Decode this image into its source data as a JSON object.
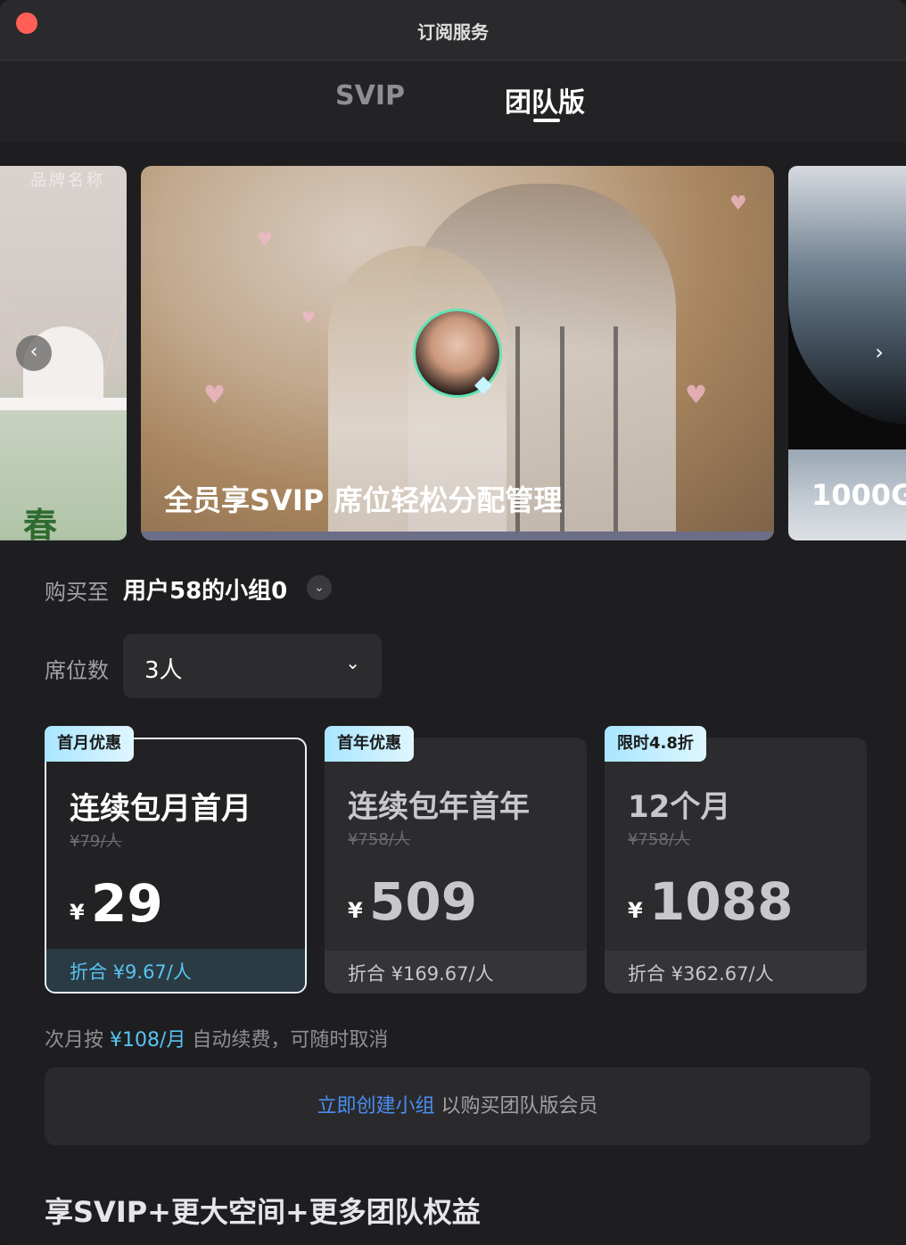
{
  "window": {
    "title": "订阅服务"
  },
  "tabs": [
    {
      "label": "SVIP",
      "active": false
    },
    {
      "label": "团队版",
      "active": true
    }
  ],
  "banners": {
    "left": {
      "brand": "品牌名称",
      "text": "春 天"
    },
    "main": {
      "caption": "全员享SVIP 席位轻松分配管理"
    },
    "right": {
      "caption": "1000G"
    },
    "prev_icon": "‹",
    "next_icon": "›"
  },
  "purchase": {
    "buy_to_label": "购买至",
    "group_name": "用户58的小组0",
    "seats_label": "席位数",
    "seats_value": "3人"
  },
  "plans": [
    {
      "badge": "首月优惠",
      "title": "连续包月首月",
      "original": "¥79/人",
      "currency": "¥",
      "price": "29",
      "per": "折合 ¥9.67/人",
      "selected": true
    },
    {
      "badge": "首年优惠",
      "title": "连续包年首年",
      "original": "¥758/人",
      "currency": "¥",
      "price": "509",
      "per": "折合 ¥169.67/人",
      "selected": false
    },
    {
      "badge": "限时4.8折",
      "title": "12个月",
      "original": "¥758/人",
      "currency": "¥",
      "price": "1088",
      "per": "折合 ¥362.67/人",
      "selected": false
    }
  ],
  "renew_note": {
    "prefix": "次月按 ",
    "price": "¥108/月",
    "suffix": " 自动续费，可随时取消"
  },
  "create_group": {
    "link": "立即创建小组",
    "text": " 以购买团队版会员"
  },
  "section_title": "享SVIP+更大空间+更多团队权益",
  "colors": {
    "accent": "#59c3f0",
    "link": "#4a8ef0",
    "close": "#ff5f57"
  }
}
